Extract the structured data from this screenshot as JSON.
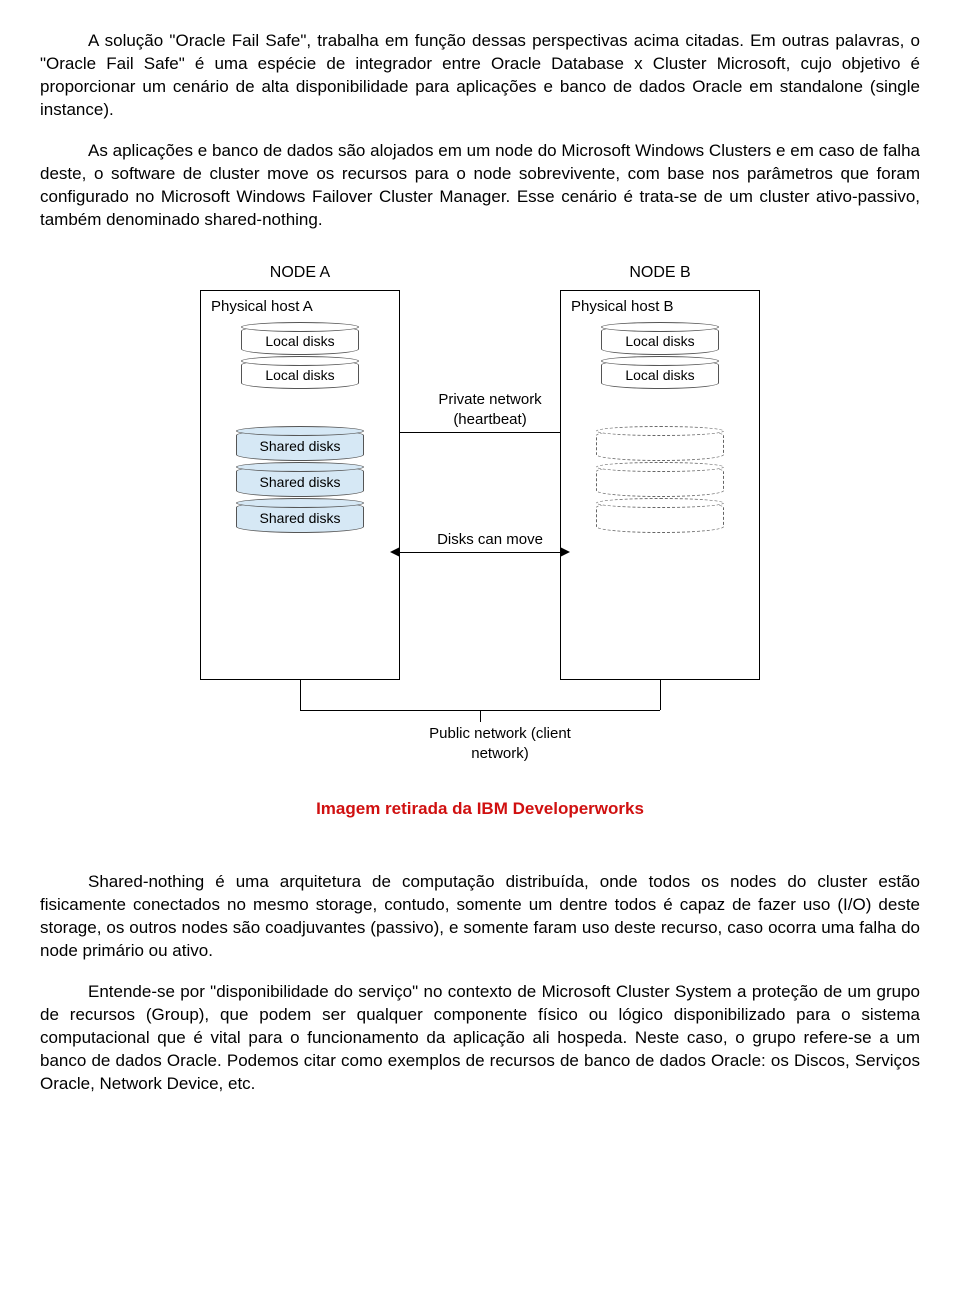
{
  "paragraphs": {
    "p1": "A solução \"Oracle Fail Safe\", trabalha em função dessas perspectivas acima citadas. Em outras palavras, o \"Oracle Fail Safe\" é uma espécie de integrador entre Oracle Database x Cluster Microsoft, cujo objetivo é proporcionar um cenário de alta disponibilidade para aplicações e banco de dados Oracle em standalone (single instance).",
    "p2": "As aplicações e banco de dados são alojados em um node do Microsoft Windows Clusters e em caso de falha deste, o software de cluster move os recursos para o node sobrevivente, com base nos parâmetros que foram configurado no Microsoft Windows Failover Cluster Manager. Esse cenário é trata-se de um cluster ativo-passivo, também denominado shared-nothing.",
    "p3": "Shared-nothing é uma arquitetura de computação distribuída, onde todos os nodes do cluster estão fisicamente conectados no mesmo storage, contudo, somente um dentre todos é capaz de fazer uso (I/O) deste storage, os outros nodes são coadjuvantes (passivo), e somente faram uso deste recurso, caso ocorra uma falha do node primário ou ativo.",
    "p4": "Entende-se por \"disponibilidade do serviço\" no contexto de Microsoft Cluster System a proteção de um grupo de recursos (Group), que podem ser qualquer componente físico ou lógico disponibilizado para o sistema computacional que é vital para o funcionamento da aplicação ali hospeda. Neste caso, o grupo refere-se a um banco de dados Oracle. Podemos citar como exemplos de recursos de banco de dados Oracle: os Discos, Serviços Oracle, Network Device, etc."
  },
  "diagram": {
    "node_a": "NODE A",
    "node_b": "NODE B",
    "host_a": "Physical host A",
    "host_b": "Physical host B",
    "local_disks": "Local disks",
    "shared_disks": "Shared disks",
    "private_net": "Private network (heartbeat)",
    "disks_move": "Disks can move",
    "public_net": "Public network (client network)"
  },
  "caption": "Imagem retirada da IBM Developerworks"
}
